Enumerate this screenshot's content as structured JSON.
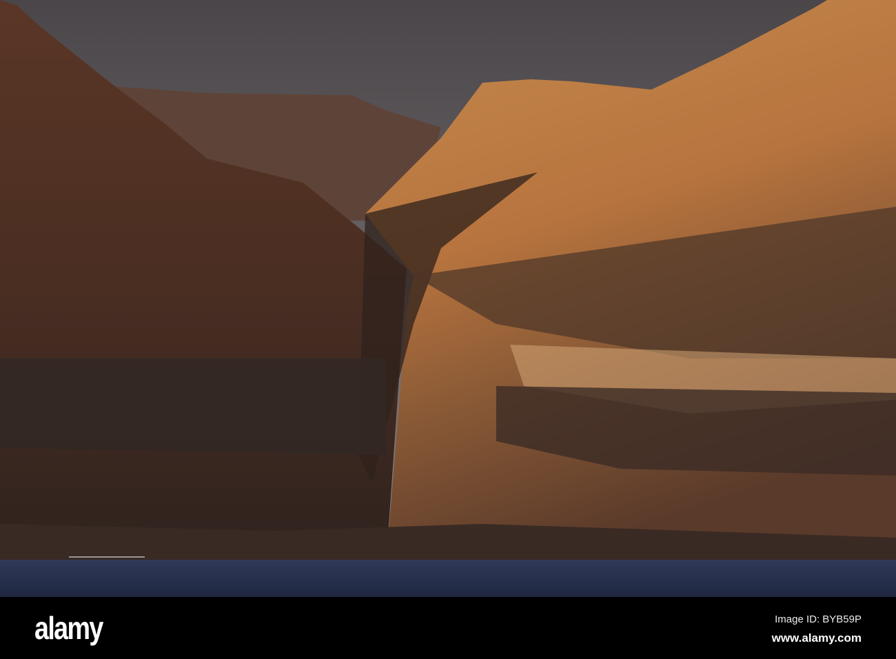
{
  "photo": {
    "subject": "Volcanic coastal cliffs at sunset above the sea",
    "colors": {
      "sky": "#5b5759",
      "cliff_lit": "#c9874a",
      "cliff_shadow": "#3a2620",
      "sea": "#2a3550"
    }
  },
  "watermark": {
    "logo": "alamy",
    "image_id": "Image ID: BYB59P",
    "site": "www.alamy.com"
  }
}
